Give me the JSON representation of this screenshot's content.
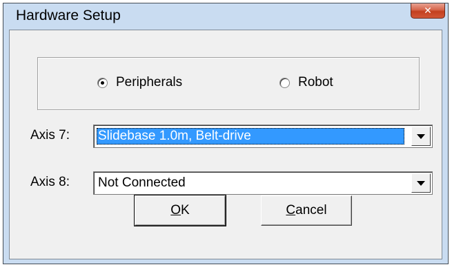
{
  "window": {
    "title": "Hardware Setup",
    "close_icon": "close-icon",
    "close_glyph": "✕"
  },
  "mode": {
    "options": [
      {
        "label": "Peripherals",
        "selected": true
      },
      {
        "label": "Robot",
        "selected": false
      }
    ]
  },
  "axes": [
    {
      "label": "Axis 7:",
      "value": "Slidebase 1.0m, Belt-drive",
      "focused": true
    },
    {
      "label": "Axis 8:",
      "value": "Not Connected",
      "focused": false
    }
  ],
  "buttons": {
    "ok": {
      "mnemonic": "O",
      "rest": "K"
    },
    "cancel": {
      "mnemonic": "C",
      "rest": "ancel"
    }
  }
}
